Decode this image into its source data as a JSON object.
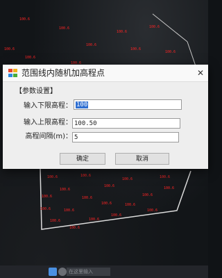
{
  "dialog": {
    "title": "范围线内随机加高程点",
    "group_title": "【参数设置】",
    "fields": [
      {
        "label": "输入下限高程：",
        "value": "100"
      },
      {
        "label": "输入上限高程：",
        "value": "100.50"
      },
      {
        "label": "高程间隔(m)：",
        "value": "5"
      }
    ],
    "ok_label": "确定",
    "cancel_label": "取消",
    "close_glyph": "✕"
  },
  "background": {
    "point_label": "100.6"
  },
  "taskbar": {
    "search_text": "在这里输入"
  },
  "colors": {
    "point_red": "#ff2424",
    "selection_blue": "#2f6fd1",
    "dialog_bg": "#eeeeee"
  }
}
